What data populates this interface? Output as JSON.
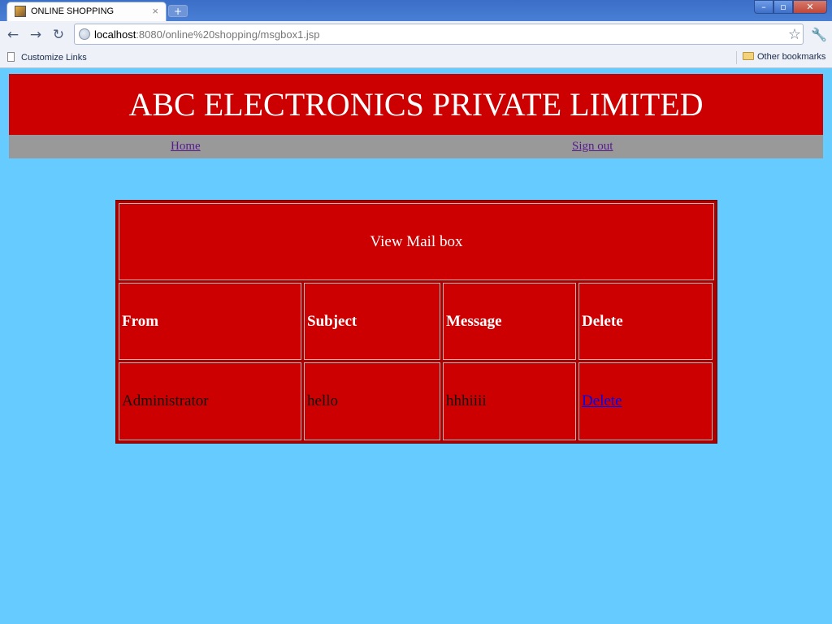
{
  "browser": {
    "tab_title": "ONLINE SHOPPING",
    "new_tab_symbol": "+",
    "url_host": "localhost",
    "url_rest": ":8080/online%20shopping/msgbox1.jsp",
    "bookmark_left": "Customize Links",
    "bookmark_right": "Other bookmarks"
  },
  "site": {
    "company_title": "ABC ELECTRONICS PRIVATE LIMITED",
    "nav": {
      "home": "Home",
      "sign_out": "Sign out"
    }
  },
  "mailbox": {
    "title": "View Mail box",
    "columns": [
      "From",
      "Subject",
      "Message",
      "Delete"
    ],
    "rows": [
      {
        "from": "Administrator",
        "subject": "hello",
        "message": "hhhiiii",
        "delete": "Delete"
      }
    ]
  },
  "colors": {
    "page_bg": "#66ccff",
    "banner_bg": "#cc0000",
    "nav_bg": "#999999"
  }
}
